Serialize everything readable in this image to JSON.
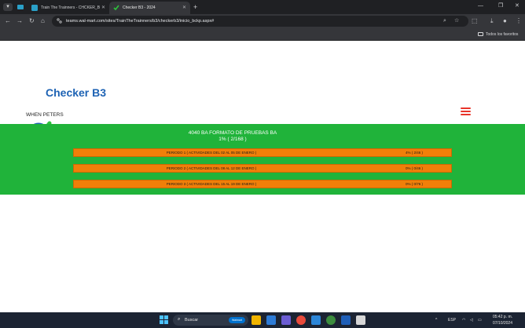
{
  "browser": {
    "tabs": [
      {
        "title": "Train The Trainners - CHCKER_B",
        "active": false
      },
      {
        "title": "Checker B3 - 2024",
        "active": true
      }
    ],
    "url": "teams.wal-mart.com/sites/TrainTheTrainners/b3/checkerb3/inicio_bckp.aspx#",
    "bookmark_folder": "Todos los favoritos",
    "icons": [
      "back-icon",
      "forward-icon",
      "reload-icon",
      "home-icon",
      "site-info-icon",
      "zoom-icon",
      "star-icon",
      "extensions-icon",
      "download-icon",
      "profile-icon",
      "menu-icon"
    ]
  },
  "page": {
    "logo_text": "Checker B3",
    "user": "WHEN PETERS",
    "course": {
      "title": "4040 BA FORMATO DE PRUEBAS BA",
      "progress": "1% ( 2/168 )"
    },
    "periods": [
      {
        "label": "PERIODO 1 ( ACTIVIDADES DEL 02 AL 05 DE ENERO )",
        "value": "4% ( 2/46 )"
      },
      {
        "label": "PERIODO 2 ( ACTIVIDADES DEL 08 AL 12 DE ENERO )",
        "value": "0% ( 0/46 )"
      },
      {
        "label": "PERIODO 3 ( ACTIVIDADES DEL 15 AL 19 DE ENERO )",
        "value": "0% ( 0/76 )"
      }
    ]
  },
  "taskbar": {
    "search_placeholder": "Buscar",
    "search_badge": "Walmart",
    "language": "ESP",
    "time": "05:42 p. m.",
    "date": "07/10/2024"
  },
  "colors": {
    "panel_green": "#20b33a",
    "period_orange": "#f07f09",
    "logo_blue": "#1e63b4",
    "menu_red": "#e8342a"
  }
}
